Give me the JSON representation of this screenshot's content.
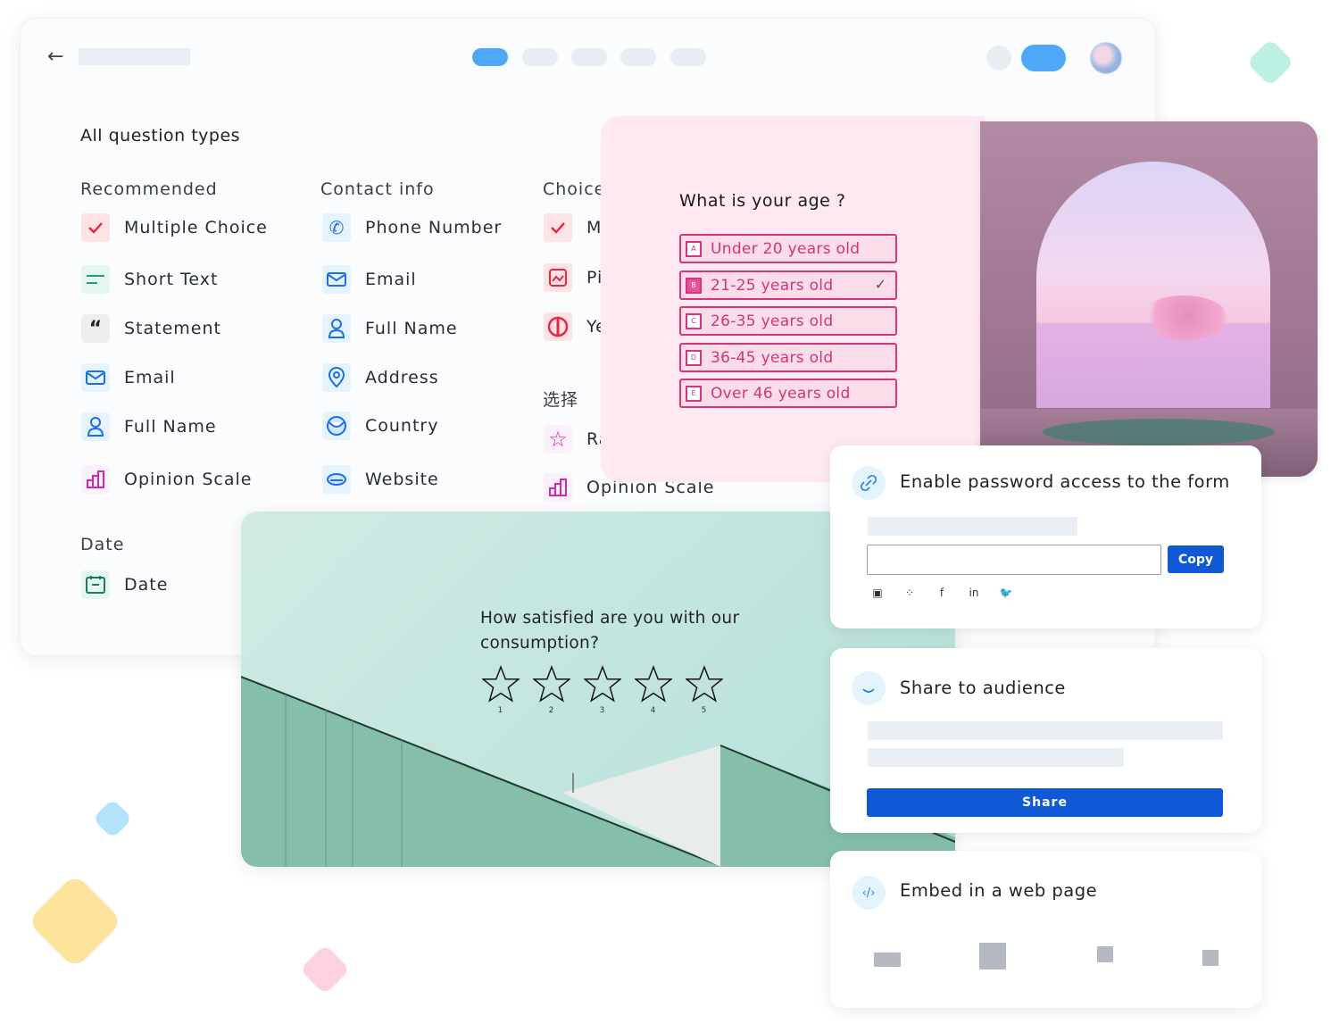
{
  "decorations": {
    "diamonds": [
      {
        "name": "mint",
        "color": "#bdf0e4"
      },
      {
        "name": "blue",
        "color": "#b3e2fb"
      },
      {
        "name": "yellow",
        "color": "#fee39c"
      },
      {
        "name": "pink",
        "color": "#fdd0e2"
      }
    ]
  },
  "builder": {
    "back_icon": "←",
    "tabs": [
      {
        "id": "tab-1",
        "active": true
      },
      {
        "id": "tab-2",
        "active": false
      },
      {
        "id": "tab-3",
        "active": false
      },
      {
        "id": "tab-4",
        "active": false
      },
      {
        "id": "tab-5",
        "active": false
      }
    ],
    "accent_color": "#4ea8f7",
    "section_title": "All question types",
    "groups": [
      {
        "label": "Recommended",
        "items": [
          {
            "label": "Multiple Choice",
            "icon": "checkmark-icon"
          },
          {
            "label": "Short Text",
            "icon": "short-text-icon"
          },
          {
            "label": "Statement",
            "icon": "quote-icon"
          },
          {
            "label": "Email",
            "icon": "email-icon"
          },
          {
            "label": "Full Name",
            "icon": "person-icon"
          },
          {
            "label": "Opinion Scale",
            "icon": "bar-chart-icon"
          }
        ]
      },
      {
        "label": "Contact info",
        "items": [
          {
            "label": "Phone Number",
            "icon": "phone-icon"
          },
          {
            "label": "Email",
            "icon": "email-icon"
          },
          {
            "label": "Full Name",
            "icon": "person-icon"
          },
          {
            "label": "Address",
            "icon": "location-pin-icon"
          },
          {
            "label": "Country",
            "icon": "globe-icon"
          },
          {
            "label": "Website",
            "icon": "link-icon"
          }
        ]
      },
      {
        "label": "Choice",
        "items": [
          {
            "label": "M",
            "icon": "checkmark-icon"
          },
          {
            "label": "Pi",
            "icon": "picture-icon"
          },
          {
            "label": "Ye",
            "icon": "yes-no-icon"
          }
        ]
      },
      {
        "label": "选择",
        "items": [
          {
            "label": "Ra",
            "icon": "star-icon"
          },
          {
            "label": "Opinion Scale",
            "icon": "bar-chart-icon"
          }
        ]
      },
      {
        "label": "Date",
        "items": [
          {
            "label": "Date",
            "icon": "calendar-icon"
          }
        ]
      }
    ]
  },
  "age_question": {
    "question": "What is your age ?",
    "options": [
      {
        "key": "A",
        "label": "Under 20 years old",
        "selected": false
      },
      {
        "key": "B",
        "label": "21-25 years old",
        "selected": true
      },
      {
        "key": "C",
        "label": "26-35 years old",
        "selected": false
      },
      {
        "key": "D",
        "label": "36-45 years old",
        "selected": false
      },
      {
        "key": "E",
        "label": "Over 46 years old",
        "selected": false
      }
    ],
    "check_mark": "✓",
    "accent_color": "#d6367f"
  },
  "satisfaction": {
    "question": "How satisfied are you with our consumption?",
    "rating_max": 5,
    "rating_value": 0,
    "star_labels": [
      "1",
      "2",
      "3",
      "4",
      "5"
    ]
  },
  "password_card": {
    "title": "Enable password access to the form",
    "icon": "link-icon",
    "link_value": "",
    "copy_label": "Copy",
    "share_icons": [
      "image-icon",
      "qr-code-icon",
      "facebook-icon",
      "linkedin-icon",
      "twitter-icon"
    ],
    "share_glyphs": [
      "▣",
      "⁘",
      "f",
      "in",
      "🐦"
    ]
  },
  "audience_card": {
    "title": "Share to audience",
    "icon": "smile-icon",
    "share_label": "Share"
  },
  "embed_card": {
    "title": "Embed in a web page",
    "icon": "code-icon",
    "icon_glyph": "‹/›",
    "options": [
      "standard-embed",
      "full-page-embed",
      "popup-embed",
      "side-panel-embed"
    ]
  }
}
